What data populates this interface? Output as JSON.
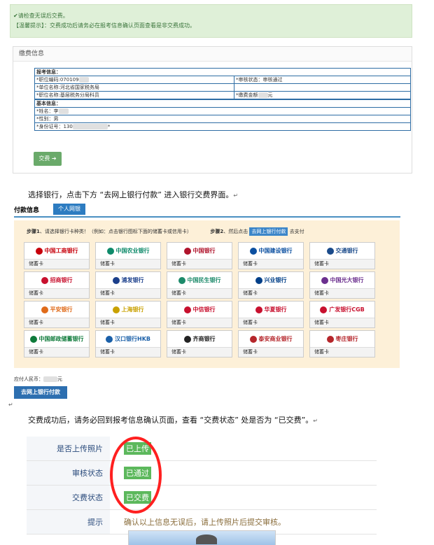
{
  "notice": {
    "line1": "✔请检查无误后交费。",
    "line2": "【温馨提示】：交费成功后请务必在报考信息确认页面查看是非交费成功。"
  },
  "fee_panel": {
    "title": "缴费信息",
    "exam_info_label": "报考信息：",
    "position_code": "*职位编码:070109",
    "unit_name": "*单位名称:河北省国家税务局",
    "position_name": "*职位名称:基层税务分局科员",
    "review_status": "*审核状态：审核通过",
    "fee_amount": "*缴费金额",
    "fee_unit": "元",
    "basic_info_label": "基本信息：",
    "name": "*姓名：李",
    "gender": "*性别：男",
    "id_number": "*身份证号：130",
    "id_suffix": "*",
    "pay_button": "交费 ➔"
  },
  "para1": "选择银行，点击下方 “去网上银行付款” 进入银行交费界面。",
  "para_mark": "↵",
  "payment": {
    "tab_title": "付款信息",
    "tab_active": "个人网银",
    "step1_bold": "步骤1",
    "step1_text": "、请选择银行卡种类！（例如：点击银行图标下面的储蓄卡或信用卡）",
    "step2_bold": "步骤2",
    "step2_text": "、然后点击",
    "step2_button": "去网上银行付款",
    "step2_after": "去支付",
    "card_label": "储蓄卡",
    "banks": [
      {
        "name": "中国工商银行",
        "color": "#c7000b"
      },
      {
        "name": "中国农业银行",
        "color": "#0e8a6a"
      },
      {
        "name": "中国银行",
        "color": "#b0142c"
      },
      {
        "name": "中国建设银行",
        "color": "#0b4fa0"
      },
      {
        "name": "交通银行",
        "color": "#1a4a8a"
      },
      {
        "name": "招商银行",
        "color": "#c8102e"
      },
      {
        "name": "浦发银行",
        "color": "#1b3f8b"
      },
      {
        "name": "中国民生银行",
        "color": "#1c8a6a"
      },
      {
        "name": "兴业银行",
        "color": "#003f88"
      },
      {
        "name": "中国光大银行",
        "color": "#6b2f8e"
      },
      {
        "name": "平安银行",
        "color": "#e06b1a"
      },
      {
        "name": "上海银行",
        "color": "#c9a100"
      },
      {
        "name": "中信银行",
        "color": "#c8102e"
      },
      {
        "name": "华夏银行",
        "color": "#c8102e"
      },
      {
        "name": "广发银行CGB",
        "color": "#c8102e"
      },
      {
        "name": "中国邮政储蓄银行",
        "color": "#0e7a3a"
      },
      {
        "name": "汉口银行HKB",
        "color": "#1a5fa8"
      },
      {
        "name": "齐商银行",
        "color": "#222222"
      },
      {
        "name": "泰安商业银行",
        "color": "#b5262b"
      },
      {
        "name": "枣庄银行",
        "color": "#b5262b"
      }
    ],
    "amount_label": "应付人民币：",
    "amount_unit": "元",
    "go_button": "去网上银行付款"
  },
  "para2": "交费成功后，请务必回到报考信息确认页面，查看 “交费状态” 处是否为 “已交费”。",
  "status": {
    "rows": [
      {
        "key": "是否上传照片",
        "value": "已上传"
      },
      {
        "key": "审核状态",
        "value": "已通过"
      },
      {
        "key": "交费状态",
        "value": "已交费"
      }
    ],
    "hint_key": "提示",
    "hint_value": "确认以上信息无误后，请上传照片后提交审核。"
  }
}
